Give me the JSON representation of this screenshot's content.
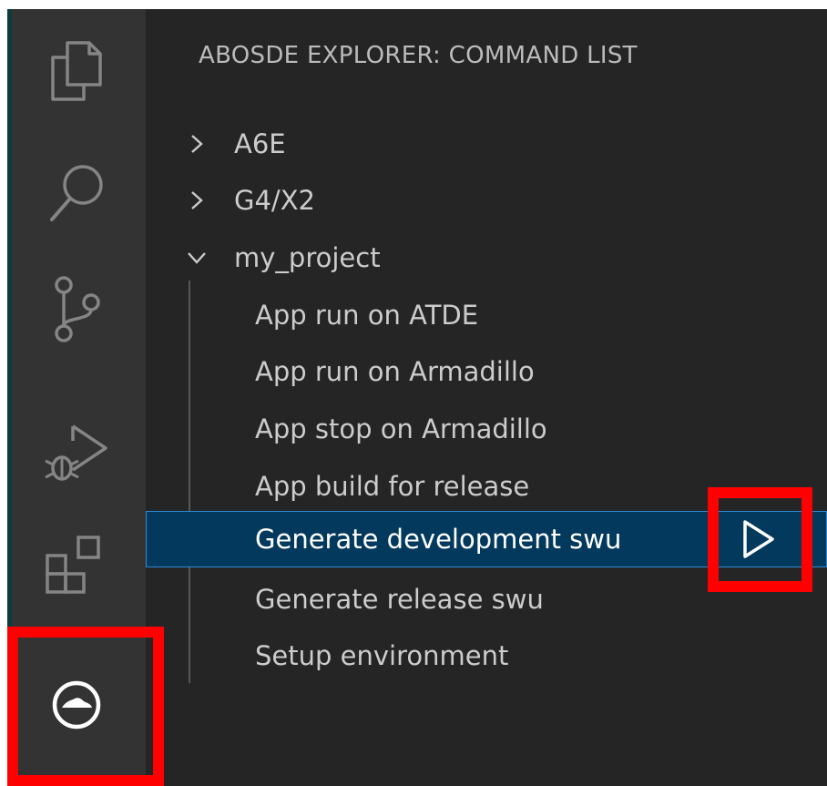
{
  "activity_bar": {
    "icons": [
      "files-icon",
      "search-icon",
      "source-control-icon",
      "run-debug-icon",
      "extensions-icon",
      "abosde-icon"
    ]
  },
  "sidebar": {
    "title": "ABOSDE EXPLORER: COMMAND LIST",
    "folders": [
      {
        "label": "A6E",
        "expanded": false
      },
      {
        "label": "G4/X2",
        "expanded": false
      },
      {
        "label": "my_project",
        "expanded": true
      }
    ],
    "commands": [
      {
        "label": "App run on ATDE"
      },
      {
        "label": "App run on Armadillo"
      },
      {
        "label": "App stop on Armadillo"
      },
      {
        "label": "App build for release"
      },
      {
        "label": "Generate development swu",
        "selected": true
      },
      {
        "label": "Generate release swu"
      },
      {
        "label": "Setup environment"
      }
    ]
  },
  "colors": {
    "activity_bar_bg": "#333333",
    "sidebar_bg": "#252526",
    "selection_bg": "#04395e",
    "selection_border": "#2a8ad6",
    "highlight": "#ff0000"
  }
}
